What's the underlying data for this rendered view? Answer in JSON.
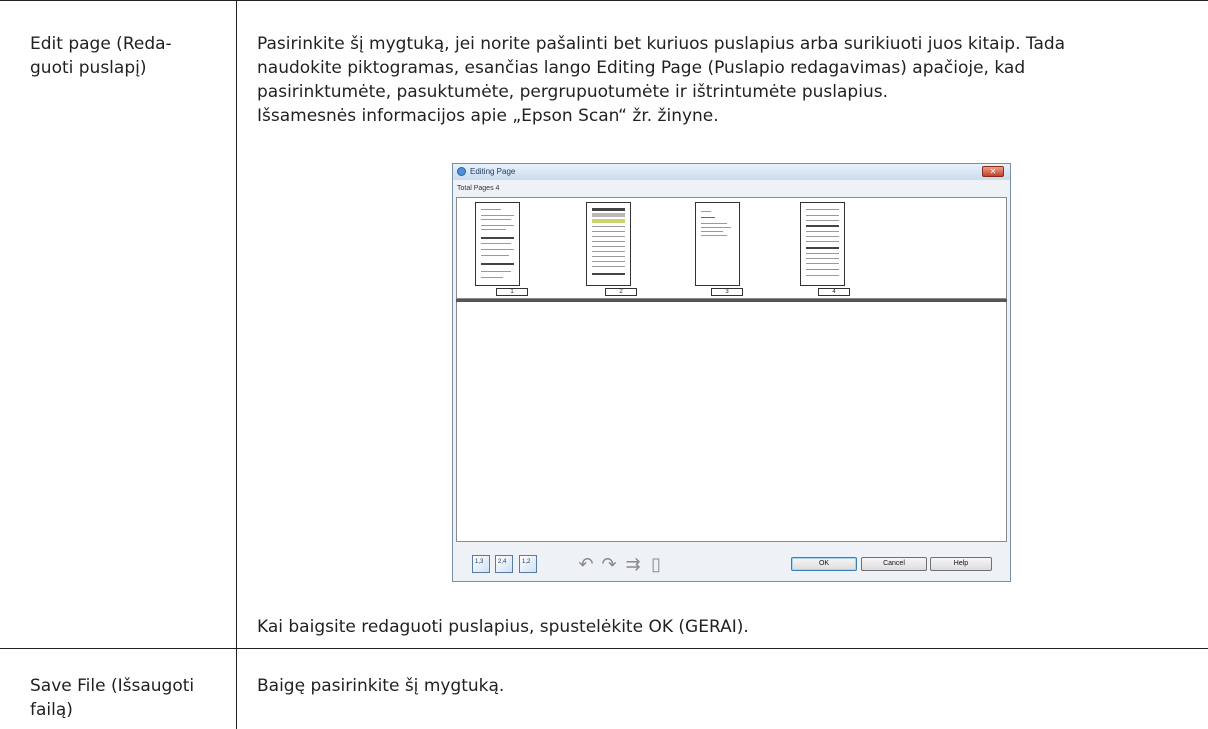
{
  "rows": [
    {
      "label_line1": "Edit page (Reda-",
      "label_line2": "guoti puslapį)",
      "desc_lines": [
        "Pasirinkite šį mygtuką, jei norite pašalinti bet kuriuos puslapius arba surikiuoti juos kitaip. Tada",
        "naudokite piktogramas, esančias lango Editing Page (Puslapio redagavimas) apačioje, kad",
        "pasirinktumėte, pasuktumėte, pergrupuotumėte ir ištrintumėte puslapius.",
        "Išsamesnės informacijos apie „Epson Scan“ žr. žinyne."
      ],
      "after_text": "Kai baigsite redaguoti puslapius, spustelėkite OK (GERAI)."
    },
    {
      "label_line1": "Save File (Išsaugoti",
      "label_line2": "failą)",
      "desc": "Baigę pasirinkite šį mygtuką."
    }
  ],
  "dialog": {
    "title": "Editing Page",
    "total_pages": "Total Pages 4",
    "page_numbers": [
      "1",
      "2",
      "3",
      "4"
    ],
    "toolbar_icons": [
      "odd-pages-icon",
      "even-pages-icon",
      "all-pages-icon",
      "rotate-left-icon",
      "rotate-right-icon",
      "reorder-icon",
      "delete-icon"
    ],
    "buttons": {
      "ok": "OK",
      "cancel": "Cancel",
      "help": "Help"
    }
  }
}
